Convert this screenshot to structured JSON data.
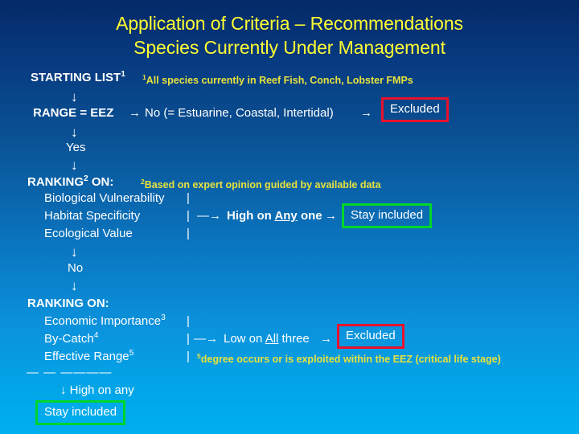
{
  "title": {
    "line1": "Application of Criteria – Recommendations",
    "line2": "Species Currently Under Management",
    "color": "#ffff33"
  },
  "colors": {
    "background_top": "#052a67",
    "background_bottom": "#00aeef",
    "title_text": "#ffff33",
    "body_text": "#ffffff",
    "footnote_text": "#e8e23c",
    "excluded_box_border": "#e8112d",
    "stay_included_box_border": "#00d62a"
  },
  "flow": {
    "starting_list_label": "STARTING LIST",
    "starting_list_sup": "1",
    "footnote1": "All species currently  in Reef Fish, Conch, Lobster FMPs",
    "footnote1_sup": "1",
    "arrow_down_1": "↓",
    "range_label": "RANGE = EEZ",
    "range_arrow_1": "→",
    "range_no_text": "No (= Estuarine, Coastal, Intertidal)",
    "range_arrow_2": "→",
    "excluded_box_1": "Excluded",
    "arrow_down_2": "↓",
    "yes_text": "Yes",
    "arrow_down_3": "↓",
    "ranking2_label": "RANKING",
    "ranking2_sup": "2",
    "ranking2_on": " ON:",
    "footnote2": "Based on expert opinion guided by available data",
    "footnote2_sup": "2",
    "criteria_a": [
      "Biological Vulnerability",
      "Habitat Specificity",
      "Ecological Value"
    ],
    "pipe": "|",
    "bracket_arrow_a": "—→",
    "high_on_text_pre": "High on ",
    "high_on_text_underline": "Any",
    "high_on_text_post": " one",
    "arrow_right_a": "→",
    "stay_included_box_1": "Stay included",
    "arrow_down_4": "↓",
    "no_text": "No",
    "arrow_down_5": "↓",
    "ranking_on_label": "RANKING ON:",
    "criteria_b": [
      {
        "text": "Economic Importance",
        "sup": "3"
      },
      {
        "text": "By-Catch",
        "sup": "4"
      },
      {
        "text": "Effective Range",
        "sup": "5"
      }
    ],
    "bracket_arrow_b": "—→",
    "low_on_text_pre": "Low on ",
    "low_on_text_underline": "All",
    "low_on_text_post": " three",
    "arrow_right_b": "→",
    "excluded_box_2": "Excluded",
    "footnote5_sup": "5",
    "footnote5": "degree  occurs or is exploited within the EEZ (critical life stage)",
    "dashes": "— — ————",
    "high_on_any": "↓ High on any",
    "stay_included_box_2": "Stay included"
  }
}
